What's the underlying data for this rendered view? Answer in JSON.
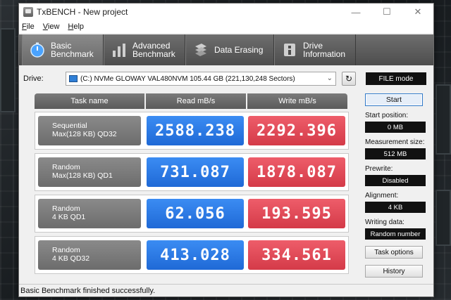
{
  "window": {
    "title": "TxBENCH - New project"
  },
  "menu": [
    {
      "label": "File",
      "key": "F"
    },
    {
      "label": "View",
      "key": "V"
    },
    {
      "label": "Help",
      "key": "H"
    }
  ],
  "toolbar": {
    "tabs": [
      {
        "label": "Basic\nBenchmark",
        "icon": "stopwatch-icon",
        "active": true
      },
      {
        "label": "Advanced\nBenchmark",
        "icon": "bar-chart-icon",
        "active": false
      },
      {
        "label": "Data Erasing",
        "icon": "eraser-icon",
        "active": false
      },
      {
        "label": "Drive\nInformation",
        "icon": "drive-info-icon",
        "active": false
      }
    ]
  },
  "drive": {
    "label": "Drive:",
    "selected": "(C:) NVMe GLOWAY VAL480NVM  105.44 GB (221,130,248 Sectors)",
    "mode": "FILE mode"
  },
  "table": {
    "headers": [
      "Task name",
      "Read mB/s",
      "Write mB/s"
    ],
    "rows": [
      {
        "task_line1": "Sequential",
        "task_line2": "Max(128 KB) QD32",
        "read": "2588.238",
        "write": "2292.396"
      },
      {
        "task_line1": "Random",
        "task_line2": "Max(128 KB) QD1",
        "read": "731.087",
        "write": "1878.087"
      },
      {
        "task_line1": "Random",
        "task_line2": "4 KB QD1",
        "read": "62.056",
        "write": "193.595"
      },
      {
        "task_line1": "Random",
        "task_line2": "4 KB QD32",
        "read": "413.028",
        "write": "334.561"
      }
    ]
  },
  "side": {
    "start_label": "Start",
    "start_position_label": "Start position:",
    "start_position_value": "0 MB",
    "measurement_size_label": "Measurement size:",
    "measurement_size_value": "512 MB",
    "prewrite_label": "Prewrite:",
    "prewrite_value": "Disabled",
    "alignment_label": "Alignment:",
    "alignment_value": "4 KB",
    "writing_data_label": "Writing data:",
    "writing_data_value": "Random number",
    "task_options_label": "Task options",
    "history_label": "History"
  },
  "status": {
    "text": "Basic Benchmark finished successfully."
  },
  "colors": {
    "read": "#2a79e6",
    "write": "#e24a58",
    "toolbar": "#5c5c5c"
  }
}
